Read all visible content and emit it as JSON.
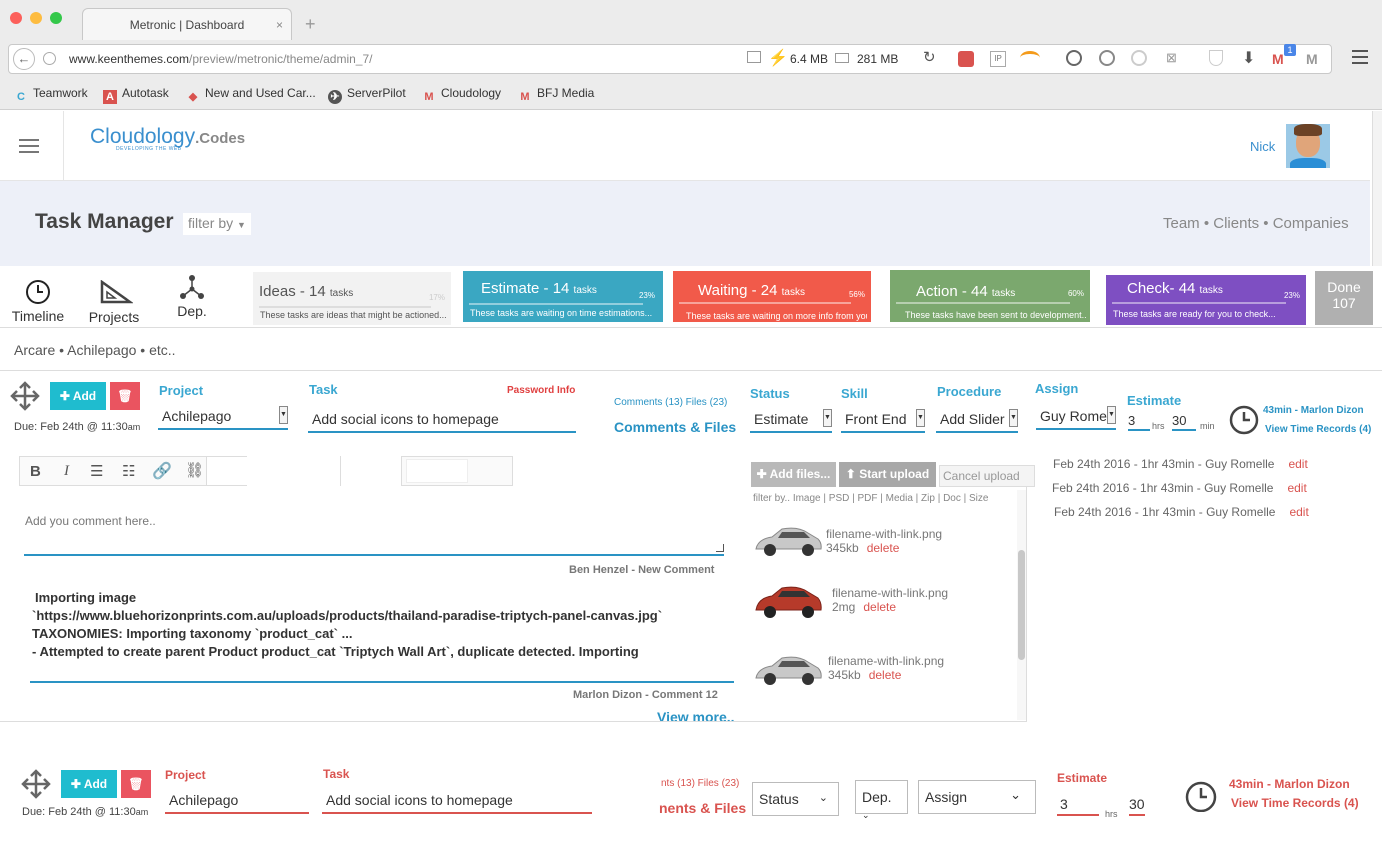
{
  "browser": {
    "tab_title": "Metronic | Dashboard",
    "url_host": "www.keenthemes.com",
    "url_path": "/preview/metronic/theme/admin_7/",
    "mem1": "6.4 MB",
    "mem2": "281 MB",
    "gmail_badge": "1",
    "bookmarks": [
      "Teamwork",
      "Autotask",
      "New and Used Car...",
      "ServerPilot",
      "Cloudology",
      "BFJ Media"
    ]
  },
  "header": {
    "logo_main": "Cloudology",
    "logo_suffix": ".Codes",
    "logo_tagline": "DEVELOPING THE WEB",
    "user_name": "Nick"
  },
  "subheader": {
    "title": "Task Manager",
    "filter_label": "filter by",
    "right_links": "Team • Clients • Companies"
  },
  "views": {
    "timeline": "Timeline",
    "projects": "Projects",
    "dep": "Dep."
  },
  "stages": [
    {
      "name": "Ideas - ",
      "count": "14",
      "unit": "tasks",
      "pct": "17%",
      "desc": "These tasks are ideas that might be actioned...",
      "color": "#f2f2f2"
    },
    {
      "name": "Estimate - ",
      "count": "14",
      "unit": "tasks",
      "pct": "23%",
      "desc": "These tasks are waiting on time estimations...",
      "color": "#3aa7c2"
    },
    {
      "name": "Waiting - ",
      "count": "24",
      "unit": "tasks",
      "pct": "56%",
      "desc": "These tasks are waiting on more info from you...",
      "color": "#f15a4a"
    },
    {
      "name": "Action - ",
      "count": "44",
      "unit": "tasks",
      "pct": "60%",
      "desc": "These tasks have been sent to development...",
      "color": "#7ba86e"
    },
    {
      "name": "Check- ",
      "count": "44",
      "unit": "tasks",
      "pct": "23%",
      "desc": "These tasks are ready for you to check...",
      "color": "#7e4fc2"
    },
    {
      "name": "Done",
      "count": "107",
      "color": "#b0b0b0"
    }
  ],
  "project_filter": "Arcare • Achilepago • etc..",
  "task1": {
    "add_label": "Add",
    "due": "Due: Feb 24th @ 11:30",
    "due_suffix": "am",
    "project_label": "Project",
    "project_value": "Achilepago",
    "task_label": "Task",
    "password_info": "Password Info",
    "task_value": "Add social icons to homepage",
    "comments_small": "Comments (13) Files (23)",
    "comments_files": "Comments & Files",
    "status_label": "Status",
    "status_value": "Estimate",
    "skill_label": "Skill",
    "skill_value": "Front End",
    "procedure_label": "Procedure",
    "procedure_value": "Add Slider",
    "assign_label": "Assign",
    "assign_value": "Guy Rome",
    "estimate_label": "Estimate",
    "est_hrs": "3",
    "hrs_unit": "hrs",
    "est_min": "30",
    "min_unit": "min",
    "time_summary": "43min - Marlon Dizon",
    "view_time_records": "View Time Records (4)"
  },
  "editor": {
    "placeholder": "Add you comment here..",
    "comment1_author": "Ben Henzel - New Comment",
    "comment2_lines": [
      "Importing image",
      "`https://www.bluehorizonprints.com.au/uploads/products/thailand-paradise-triptych-panel-canvas.jpg`",
      "TAXONOMIES: Importing taxonomy `product_cat` ...",
      "- Attempted to create parent Product product_cat `Triptych Wall Art`, duplicate detected. Importing"
    ],
    "comment2_author": "Marlon Dizon - Comment 12",
    "view_more": "View more.."
  },
  "files": {
    "add_files": "Add files...",
    "start_upload": "Start upload",
    "cancel_upload": "Cancel upload",
    "filter": "filter by.. Image  | PSD | PDF | Media | Zip | Doc | Size",
    "items": [
      {
        "name": "filename-with-link.png",
        "size": "345kb",
        "action": "delete",
        "color": "#b8b8b8"
      },
      {
        "name": "filename-with-link.png",
        "size": "2mg",
        "action": "delete",
        "color": "#b63a2a"
      },
      {
        "name": "filename-with-link.png",
        "size": "345kb",
        "action": "delete",
        "color": "#b8b8b8"
      }
    ]
  },
  "time_records": [
    {
      "text": "Feb 24th 2016 - 1hr 43min - Guy Romelle",
      "action": "edit"
    },
    {
      "text": "Feb 24th 2016 - 1hr 43min - Guy Romelle",
      "action": "edit"
    },
    {
      "text": "Feb 24th 2016 - 1hr 43min - Guy Romelle",
      "action": "edit"
    }
  ],
  "task2": {
    "add_label": "Add",
    "due": "Due: Feb 24th @ 11:30",
    "due_suffix": "am",
    "project_label": "Project",
    "project_value": "Achilepago",
    "task_label": "Task",
    "task_value": "Add social icons to homepage",
    "comments_small": "nts (13) Files (23)",
    "comments_files": "nents & Files",
    "status_value": "Status",
    "dep_value": "Dep.",
    "assign_value": "Assign",
    "estimate_label": "Estimate",
    "est_hrs": "3",
    "hrs_unit": "hrs",
    "est_min": "30",
    "time_summary": "43min - Marlon Dizon",
    "view_time_records": "View Time Records (4)"
  }
}
